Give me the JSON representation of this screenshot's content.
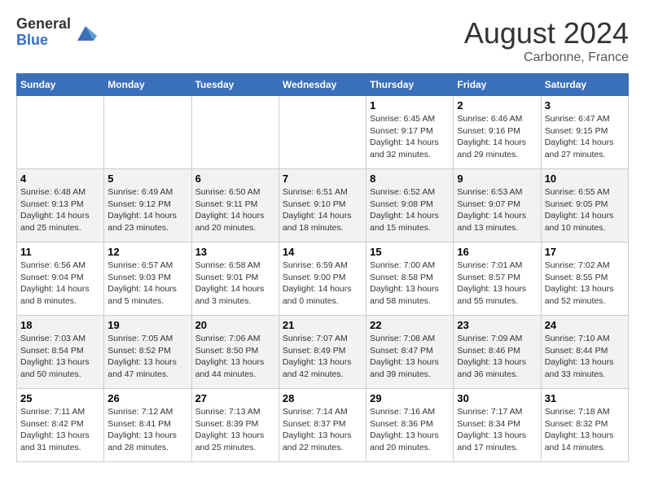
{
  "logo": {
    "general": "General",
    "blue": "Blue"
  },
  "title": "August 2024",
  "location": "Carbonne, France",
  "days_of_week": [
    "Sunday",
    "Monday",
    "Tuesday",
    "Wednesday",
    "Thursday",
    "Friday",
    "Saturday"
  ],
  "weeks": [
    [
      {
        "day": "",
        "info": ""
      },
      {
        "day": "",
        "info": ""
      },
      {
        "day": "",
        "info": ""
      },
      {
        "day": "",
        "info": ""
      },
      {
        "day": "1",
        "info": "Sunrise: 6:45 AM\nSunset: 9:17 PM\nDaylight: 14 hours\nand 32 minutes."
      },
      {
        "day": "2",
        "info": "Sunrise: 6:46 AM\nSunset: 9:16 PM\nDaylight: 14 hours\nand 29 minutes."
      },
      {
        "day": "3",
        "info": "Sunrise: 6:47 AM\nSunset: 9:15 PM\nDaylight: 14 hours\nand 27 minutes."
      }
    ],
    [
      {
        "day": "4",
        "info": "Sunrise: 6:48 AM\nSunset: 9:13 PM\nDaylight: 14 hours\nand 25 minutes."
      },
      {
        "day": "5",
        "info": "Sunrise: 6:49 AM\nSunset: 9:12 PM\nDaylight: 14 hours\nand 23 minutes."
      },
      {
        "day": "6",
        "info": "Sunrise: 6:50 AM\nSunset: 9:11 PM\nDaylight: 14 hours\nand 20 minutes."
      },
      {
        "day": "7",
        "info": "Sunrise: 6:51 AM\nSunset: 9:10 PM\nDaylight: 14 hours\nand 18 minutes."
      },
      {
        "day": "8",
        "info": "Sunrise: 6:52 AM\nSunset: 9:08 PM\nDaylight: 14 hours\nand 15 minutes."
      },
      {
        "day": "9",
        "info": "Sunrise: 6:53 AM\nSunset: 9:07 PM\nDaylight: 14 hours\nand 13 minutes."
      },
      {
        "day": "10",
        "info": "Sunrise: 6:55 AM\nSunset: 9:05 PM\nDaylight: 14 hours\nand 10 minutes."
      }
    ],
    [
      {
        "day": "11",
        "info": "Sunrise: 6:56 AM\nSunset: 9:04 PM\nDaylight: 14 hours\nand 8 minutes."
      },
      {
        "day": "12",
        "info": "Sunrise: 6:57 AM\nSunset: 9:03 PM\nDaylight: 14 hours\nand 5 minutes."
      },
      {
        "day": "13",
        "info": "Sunrise: 6:58 AM\nSunset: 9:01 PM\nDaylight: 14 hours\nand 3 minutes."
      },
      {
        "day": "14",
        "info": "Sunrise: 6:59 AM\nSunset: 9:00 PM\nDaylight: 14 hours\nand 0 minutes."
      },
      {
        "day": "15",
        "info": "Sunrise: 7:00 AM\nSunset: 8:58 PM\nDaylight: 13 hours\nand 58 minutes."
      },
      {
        "day": "16",
        "info": "Sunrise: 7:01 AM\nSunset: 8:57 PM\nDaylight: 13 hours\nand 55 minutes."
      },
      {
        "day": "17",
        "info": "Sunrise: 7:02 AM\nSunset: 8:55 PM\nDaylight: 13 hours\nand 52 minutes."
      }
    ],
    [
      {
        "day": "18",
        "info": "Sunrise: 7:03 AM\nSunset: 8:54 PM\nDaylight: 13 hours\nand 50 minutes."
      },
      {
        "day": "19",
        "info": "Sunrise: 7:05 AM\nSunset: 8:52 PM\nDaylight: 13 hours\nand 47 minutes."
      },
      {
        "day": "20",
        "info": "Sunrise: 7:06 AM\nSunset: 8:50 PM\nDaylight: 13 hours\nand 44 minutes."
      },
      {
        "day": "21",
        "info": "Sunrise: 7:07 AM\nSunset: 8:49 PM\nDaylight: 13 hours\nand 42 minutes."
      },
      {
        "day": "22",
        "info": "Sunrise: 7:08 AM\nSunset: 8:47 PM\nDaylight: 13 hours\nand 39 minutes."
      },
      {
        "day": "23",
        "info": "Sunrise: 7:09 AM\nSunset: 8:46 PM\nDaylight: 13 hours\nand 36 minutes."
      },
      {
        "day": "24",
        "info": "Sunrise: 7:10 AM\nSunset: 8:44 PM\nDaylight: 13 hours\nand 33 minutes."
      }
    ],
    [
      {
        "day": "25",
        "info": "Sunrise: 7:11 AM\nSunset: 8:42 PM\nDaylight: 13 hours\nand 31 minutes."
      },
      {
        "day": "26",
        "info": "Sunrise: 7:12 AM\nSunset: 8:41 PM\nDaylight: 13 hours\nand 28 minutes."
      },
      {
        "day": "27",
        "info": "Sunrise: 7:13 AM\nSunset: 8:39 PM\nDaylight: 13 hours\nand 25 minutes."
      },
      {
        "day": "28",
        "info": "Sunrise: 7:14 AM\nSunset: 8:37 PM\nDaylight: 13 hours\nand 22 minutes."
      },
      {
        "day": "29",
        "info": "Sunrise: 7:16 AM\nSunset: 8:36 PM\nDaylight: 13 hours\nand 20 minutes."
      },
      {
        "day": "30",
        "info": "Sunrise: 7:17 AM\nSunset: 8:34 PM\nDaylight: 13 hours\nand 17 minutes."
      },
      {
        "day": "31",
        "info": "Sunrise: 7:18 AM\nSunset: 8:32 PM\nDaylight: 13 hours\nand 14 minutes."
      }
    ]
  ]
}
